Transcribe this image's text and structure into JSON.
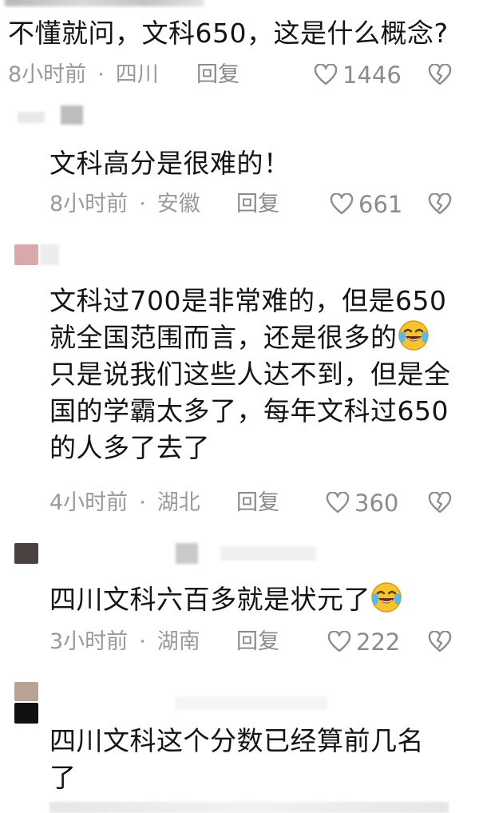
{
  "comments": [
    {
      "text": "不懂就问，文科650，这是什么概念?",
      "time": "8小时前",
      "location": "四川",
      "reply": "回复",
      "likes": "1446"
    },
    {
      "text": "文科高分是很难的！",
      "time": "8小时前",
      "location": "安徽",
      "reply": "回复",
      "likes": "661"
    },
    {
      "text_lines": [
        "文科过700是非常难的，但是650",
        "就全国范围而言，还是很多的",
        "只是说我们这些人达不到，但是全",
        "国的学霸太多了，每年文科过650",
        "的人多了去了"
      ],
      "time": "4小时前",
      "location": "湖北",
      "reply": "回复",
      "likes": "360"
    },
    {
      "text": "四川文科六百多就是状元了",
      "time": "3小时前",
      "location": "湖南",
      "reply": "回复",
      "likes": "222"
    },
    {
      "text_lines": [
        "四川文科这个分数已经算前几名",
        "了"
      ]
    }
  ],
  "icons": {
    "like": "heart-outline-icon",
    "dislike": "broken-heart-icon",
    "emoji": "laughing-tears-emoji"
  },
  "colors": {
    "text": "#141414",
    "meta": "#9a9a9a",
    "emoji_face": "#f7c430"
  }
}
